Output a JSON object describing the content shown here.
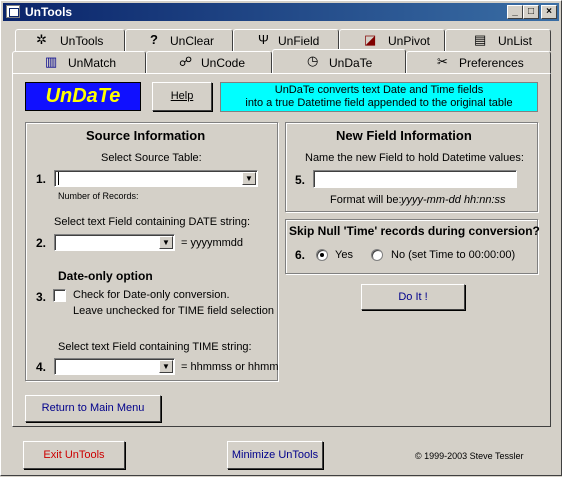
{
  "window": {
    "title": "UnTools",
    "minimize": "_",
    "maximize": "□",
    "close": "×"
  },
  "tabs_row1": [
    {
      "label": "UnTools",
      "icon": "✲"
    },
    {
      "label": "UnClear",
      "icon": "?"
    },
    {
      "label": "UnField",
      "icon": "Ψ"
    },
    {
      "label": "UnPivot",
      "icon": "◪"
    },
    {
      "label": "UnList",
      "icon": "▤"
    }
  ],
  "tabs_row2": [
    {
      "label": "UnMatch",
      "icon": "▥"
    },
    {
      "label": "UnCode",
      "icon": "☍"
    },
    {
      "label": "UnDaTe",
      "icon": "◷"
    },
    {
      "label": "Preferences",
      "icon": "✂"
    }
  ],
  "logo_text": "UnDaTe",
  "help_button": "Help",
  "info_text_1": "UnDaTe converts text Date and Time fields",
  "info_text_2": "into a true Datetime field appended to the original table",
  "source": {
    "heading": "Source Information",
    "select_table_label": "Select Source Table:",
    "step1": "1.",
    "records_label": "Number of Records:",
    "date_field_label": "Select text Field containing DATE string:",
    "step2": "2.",
    "date_format": "= yyyymmdd",
    "date_only_heading": "Date-only option",
    "step3": "3.",
    "date_only_check_1": "Check for Date-only conversion.",
    "date_only_check_2": "Leave unchecked for TIME field selection",
    "time_field_label": "Select text Field containing TIME string:",
    "step4": "4.",
    "time_format": "= hhmmss or hhmm"
  },
  "new_field": {
    "heading": "New Field Information",
    "name_label": "Name the new Field to hold Datetime values:",
    "step5": "5.",
    "format_prefix": "Format will be:",
    "format_value": "yyyy-mm-dd  hh:nn:ss"
  },
  "skip_null": {
    "heading": "Skip Null 'Time' records during conversion?",
    "step6": "6.",
    "yes_label": "Yes",
    "no_label": "No (set Time to 00:00:00)",
    "selected": "Yes"
  },
  "do_it_button": "Do It !",
  "return_button": "Return to Main Menu",
  "exit_button": "Exit UnTools",
  "minimize_button": "Minimize UnTools",
  "copyright": "© 1999-2003  Steve Tessler",
  "colors": {
    "title_bar": "#0a246a",
    "logo_bg": "#1010ff",
    "logo_text": "#ffff00",
    "info_bg": "#00ffff",
    "link_text": "#00008b",
    "exit_text": "#cc0000"
  }
}
